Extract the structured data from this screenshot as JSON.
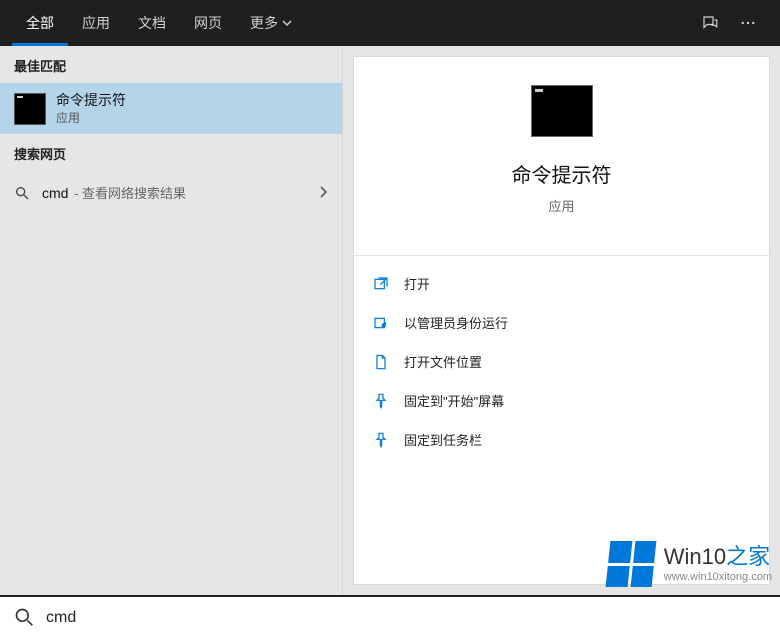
{
  "tabs": {
    "items": [
      "全部",
      "应用",
      "文档",
      "网页",
      "更多"
    ],
    "active_index": 0
  },
  "left": {
    "best_match_header": "最佳匹配",
    "result": {
      "title": "命令提示符",
      "subtitle": "应用"
    },
    "web_header": "搜索网页",
    "web_search": {
      "query": "cmd",
      "suffix": " - 查看网络搜索结果"
    }
  },
  "detail": {
    "title": "命令提示符",
    "subtitle": "应用",
    "actions": [
      {
        "icon": "open-icon",
        "label": "打开"
      },
      {
        "icon": "run-admin-icon",
        "label": "以管理员身份运行"
      },
      {
        "icon": "file-location-icon",
        "label": "打开文件位置"
      },
      {
        "icon": "pin-start-icon",
        "label": "固定到\"开始\"屏幕"
      },
      {
        "icon": "pin-taskbar-icon",
        "label": "固定到任务栏"
      }
    ]
  },
  "search_bar": {
    "value": "cmd"
  },
  "watermark": {
    "title_prefix": "Win10",
    "title_suffix": "之家",
    "url": "www.win10xitong.com"
  }
}
